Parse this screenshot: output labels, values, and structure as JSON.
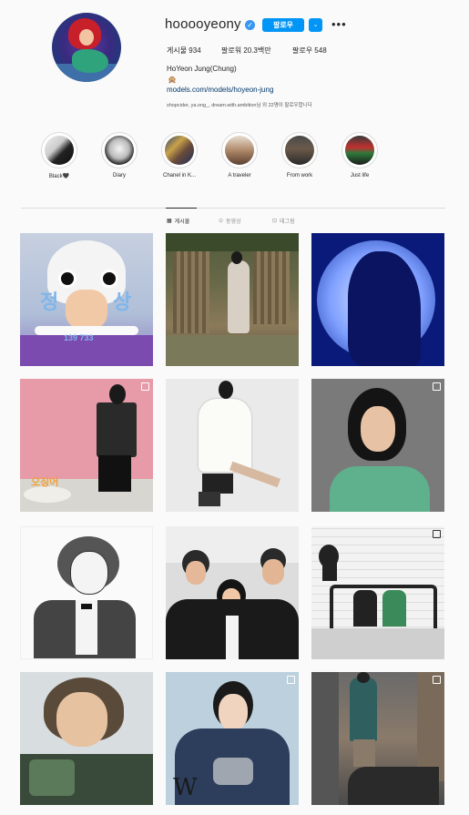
{
  "profile": {
    "username": "hooooyeony",
    "follow_label": "팔로우",
    "dropdown_glyph": "⌄",
    "more_glyph": "•••",
    "stats": {
      "posts": "게시물 934",
      "followers": "팔로워 20.3백만",
      "following": "팔로우 548"
    },
    "full_name": "HoYeon Jung(Chung)",
    "bio_emoji": "🙊",
    "link": "models.com/models/hoyeon-jung",
    "followed_by": "shopcider, ya.ong_, dream.with.ambition님 외 22명이 팔로우합니다"
  },
  "highlights": [
    {
      "label": "Black🖤"
    },
    {
      "label": "Diary"
    },
    {
      "label": "Chanel in K..."
    },
    {
      "label": "A traveler"
    },
    {
      "label": "From work"
    },
    {
      "label": "Just life"
    }
  ],
  "tabs": [
    {
      "label": "게시물",
      "icon": "grid-icon"
    },
    {
      "label": "동영상",
      "icon": "video-icon"
    },
    {
      "label": "태그됨",
      "icon": "tag-icon"
    }
  ],
  "colors": {
    "accent": "#0095f6",
    "link": "#00376b",
    "border": "#dbdbdb",
    "background": "#fafafa"
  },
  "squid_photo_text": {
    "left": "정",
    "right": "상",
    "numbers": "139 733"
  },
  "pink_photo_text": "오징어"
}
